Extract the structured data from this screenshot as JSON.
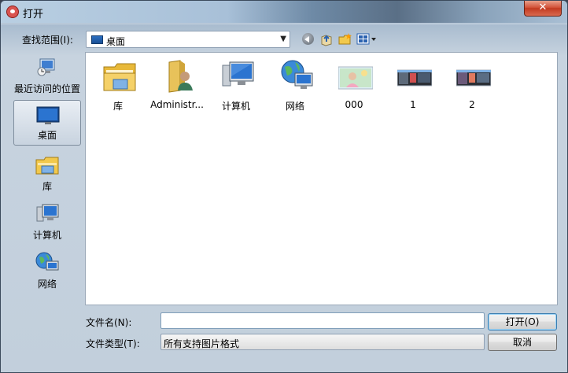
{
  "window": {
    "title": "打开",
    "close_label": "✕"
  },
  "toolbar": {
    "look_in_label": "查找范围(I):",
    "look_in_value": "桌面",
    "dropdown_arrow": "▼"
  },
  "places": [
    {
      "label": "最近访问的位置",
      "icon": "recent-places-icon"
    },
    {
      "label": "桌面",
      "icon": "desktop-icon",
      "selected": true
    },
    {
      "label": "库",
      "icon": "libraries-icon"
    },
    {
      "label": "计算机",
      "icon": "computer-icon"
    },
    {
      "label": "网络",
      "icon": "network-icon"
    }
  ],
  "files": [
    {
      "name": "库",
      "icon": "libraries-folder-icon"
    },
    {
      "name": "Administr...",
      "icon": "user-folder-icon"
    },
    {
      "name": "计算机",
      "icon": "computer-icon"
    },
    {
      "name": "网络",
      "icon": "network-icon"
    },
    {
      "name": "000",
      "icon": "image-thumbnail-icon"
    },
    {
      "name": "1",
      "icon": "image-thumbnail-icon"
    },
    {
      "name": "2",
      "icon": "image-thumbnail-icon"
    }
  ],
  "bottom": {
    "filename_label": "文件名(N):",
    "filename_value": "",
    "filetype_label": "文件类型(T):",
    "filetype_value": "所有支持图片格式",
    "open_label": "打开(O)",
    "cancel_label": "取消"
  },
  "colors": {
    "accent_blue": "#1a4f94",
    "folder_yellow": "#f2c94c",
    "close_red": "#c23a20"
  }
}
